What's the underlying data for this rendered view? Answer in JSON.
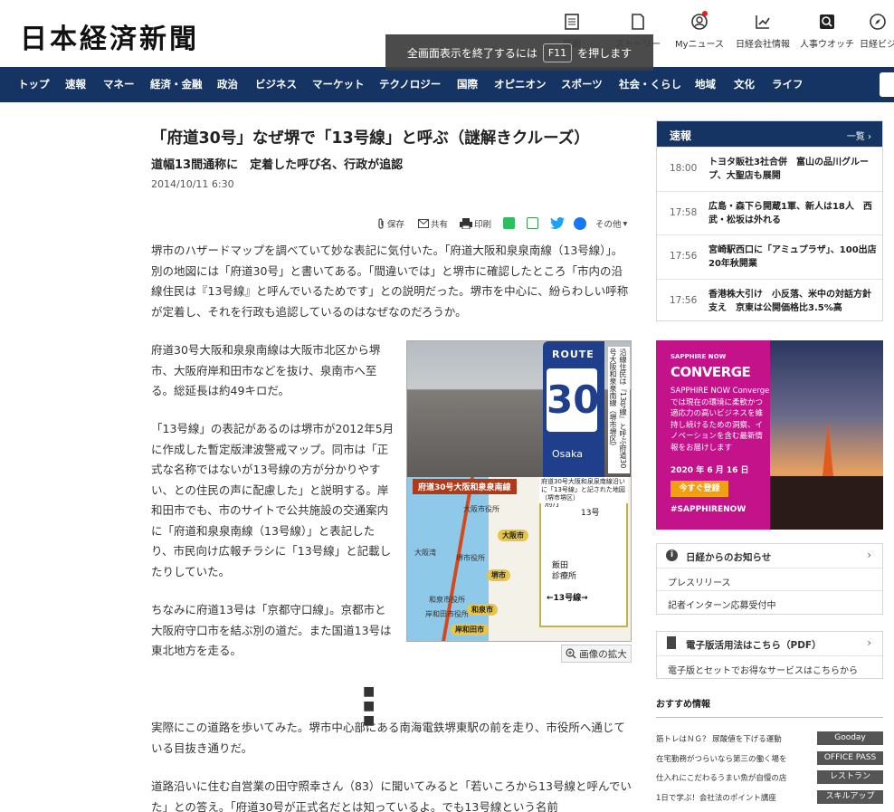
{
  "header": {
    "logo": "日本経済新聞",
    "icons": [
      {
        "icon": "paper-icon",
        "label": "紙面"
      },
      {
        "icon": "story-icon",
        "label": "ストーリー"
      },
      {
        "icon": "user-icon",
        "label": "Myニュース"
      },
      {
        "icon": "chart-icon",
        "label": "日経会社情報"
      },
      {
        "icon": "search-person-icon",
        "label": "人事ウオッチ"
      },
      {
        "icon": "compass-icon",
        "label": "日経ビジ"
      }
    ],
    "fullscreen_toast": {
      "before": "全画面表示を終了するには",
      "key": "F11",
      "after": "を押します"
    }
  },
  "nav": [
    "トップ",
    "速報",
    "マネー",
    "経済・金融",
    "政治",
    "ビジネス",
    "マーケット",
    "テクノロジー",
    "国際",
    "オピニオン",
    "スポーツ",
    "社会・くらし",
    "地域",
    "文化",
    "ライフ"
  ],
  "article": {
    "headline": "「府道30号」なぜ堺で「13号線」と呼ぶ（謎解きクルーズ）",
    "subhead": "道幅13間通称に　定着した呼び名、行政が追認",
    "date": "2014/10/11 6:30",
    "share": {
      "save": "保存",
      "share": "共有",
      "print": "印刷",
      "more": "その他"
    },
    "paragraphs": [
      "堺市のハザードマップを調べていて妙な表記に気付いた。「府道大阪和泉泉南線（13号線）」。別の地図には「府道30号」と書いてある。「間違いでは」と堺市に確認したところ「市内の沿線住民は『13号線』と呼んでいるためです」との説明だった。堺市を中心に、紛らわしい呼称が定着し、それを行政も追認しているのはなぜなのだろうか。",
      "府道30号大阪和泉泉南線は大阪市北区から堺市、大阪府岸和田市などを抜け、泉南市へ至る。総延長は約49キロだ。",
      "「13号線」の表記があるのは堺市が2012年5月に作成した暫定版津波警戒マップ。同市は「正式な名称ではないが13号線の方が分かりやすい、との住民の声に配慮した」と説明する。岸和田市でも、市のサイトで公共施設の交通案内に「府道和泉泉南線（13号線）」と表記したり、市民向け広報チラシに「13号線」と記載したりしていた。",
      "ちなみに府道13号は「京都守口線」。京都市と大阪府守口市を結ぶ別の道だ。また国道13号は東北地方を走る。",
      "実際にこの道路を歩いてみた。堺市中心部にある南海電鉄堺東駅の前を走り、市役所へ通じている目抜き通りだ。",
      "道路沿いに住む自営業の田守照幸さん（83）に聞いてみると「若いころから13号線と呼んでいた」との答え。「府道30号が正式名だとは知っているよ。でも13号線という名前"
    ],
    "separator": "■ ■ ■",
    "figure": {
      "sign_route": "ROUTE",
      "sign_number": "30",
      "sign_place": "Osaka",
      "caption_vertical": "沿線住民は『13号線』と呼ぶ府道30号大阪和泉泉南線（堺市堺区）",
      "map_title": "府道30号大阪和泉泉南線",
      "map_labels": [
        "大阪市役所",
        "大阪湾",
        "堺市役所",
        "和泉市役所",
        "岸和田市役所"
      ],
      "map_pills": [
        "大阪市",
        "堺市",
        "和泉市",
        "岸和田市"
      ],
      "inset_labels": [
        "府庁",
        "13号",
        "飯田",
        "診療所",
        "←13号線→"
      ],
      "inset_caption": "府道30号大阪和泉泉南線沿いに「13号線」と記された地図（堺市堺区）",
      "zoom_label": "画像の拡大"
    }
  },
  "sidebar": {
    "breaking": {
      "title": "速報",
      "more": "一覧",
      "items": [
        {
          "time": "18:00",
          "text": "トヨタ販社3社合併　富山の品川グループ、大聖店も展開"
        },
        {
          "time": "17:58",
          "text": "広島・森下ら開蔵1軍、新人は18人　西武・松坂は外れる"
        },
        {
          "time": "17:56",
          "text": "宮崎駅西口に「アミュプラザ」、100出店　20年秋開業"
        },
        {
          "time": "17:56",
          "text": "香港株大引け　小反落、米中の対話方針支え　京東は公開価格比3.5%高"
        }
      ]
    },
    "ad": {
      "brand": "SAPPHIRE NOW",
      "title": "CONVERGE",
      "desc": "SAPPHIRE NOW Converge では現在の環境に柔軟かつ適応力の高いビジネスを維持し続けるための洞察、イノベーションを含む最新情報をお届けします",
      "date": "2020 年 6 月 16 日",
      "cta": "今すぐ登録",
      "hashtag": "#SAPPHIRENOW"
    },
    "notice": {
      "title": "日経からのお知らせ",
      "items": [
        "プレスリリース",
        "記者インターン応募受付中"
      ]
    },
    "pdf": {
      "title": "電子版活用法はこちら（PDF）",
      "desc": "電子版とセットでお得なサービスはこちらから"
    },
    "recommend": {
      "title": "おすすめ情報",
      "items": [
        {
          "text": "筋トレはＮＧ？ 尿酸値を下げる運動",
          "tag": "Gooday"
        },
        {
          "text": "在宅勤務がつらいなら第三の働く場を",
          "tag": "OFFICE PASS"
        },
        {
          "text": "仕入れにこだわるうまい魚が自慢の店",
          "tag": "レストラン"
        },
        {
          "text": "1日で学ぶ！会社法のポイント講座",
          "tag": "スキルアップ"
        }
      ]
    }
  },
  "colors": {
    "nav_bg": "#163463",
    "ad_magenta": "#c4128a",
    "cta_orange": "#f0a010",
    "route_red": "#d44a1c"
  }
}
